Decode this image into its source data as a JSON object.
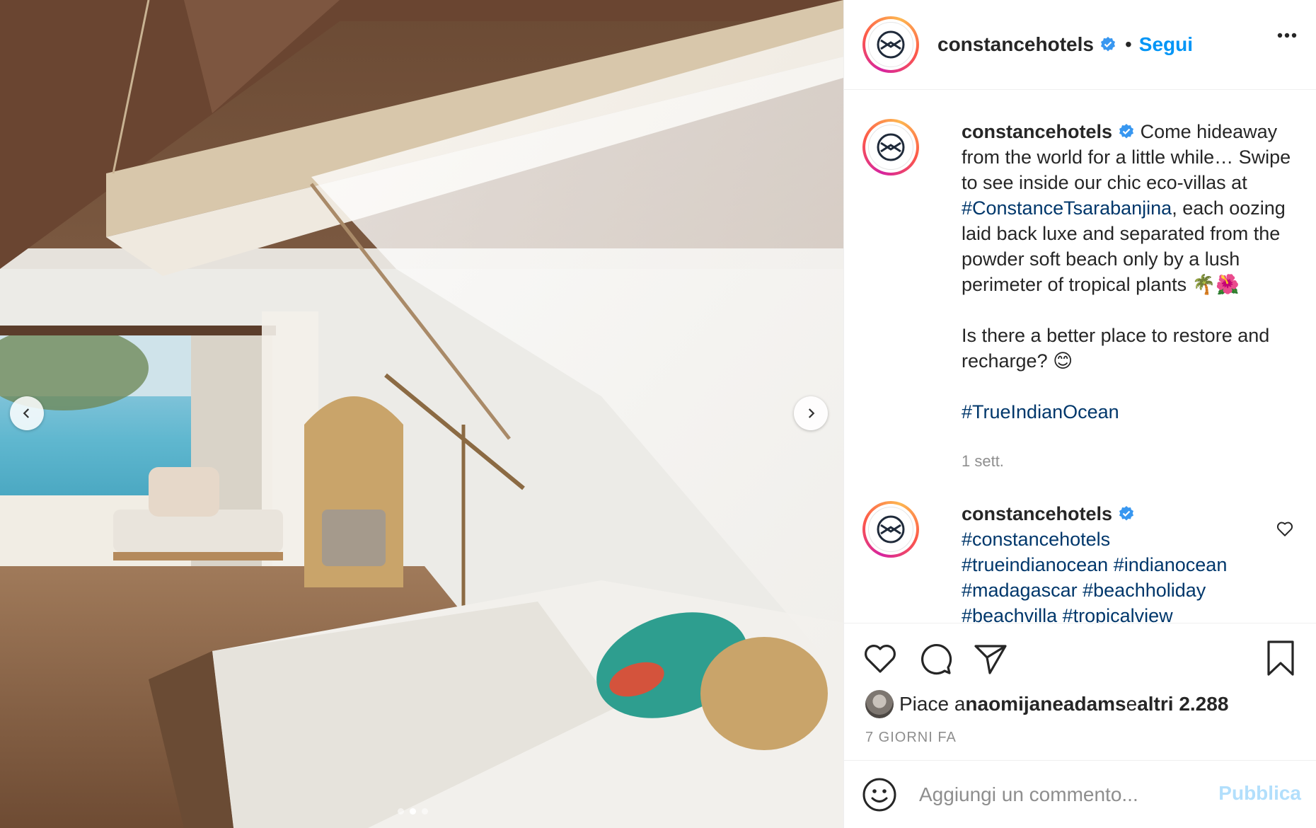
{
  "colors": {
    "accent": "#0095f6",
    "hashtag": "#00376b",
    "muted": "#8e8e8e",
    "text": "#262626",
    "verified": "#3897f0",
    "publish_disabled": "#b2dffc"
  },
  "header": {
    "username": "constancehotels",
    "separator": "•",
    "follow_label": "Segui",
    "more_icon": "more-horizontal-icon"
  },
  "carousel": {
    "slides": 3,
    "active_index": 1,
    "prev_icon": "chevron-left-icon",
    "next_icon": "chevron-right-icon"
  },
  "caption": {
    "username": "constancehotels",
    "text_part1": "Come hideaway from the world for a little while… Swipe to see inside our chic eco-villas at ",
    "tag1": "#ConstanceTsarabanjina",
    "text_part2": ", each oozing laid back luxe and separated from the powder soft beach only by a lush perimeter of tropical plants 🌴🌺",
    "text_para2": "Is there a better place to restore and recharge? 😊",
    "tag2": "#TrueIndianOcean",
    "time": "1 sett."
  },
  "comment": {
    "username": "constancehotels",
    "tags": [
      "#constancehotels",
      "#trueindianocean",
      "#indianocean",
      "#madagascar",
      "#beachholiday",
      "#beachvilla",
      "#tropicalview"
    ]
  },
  "actions": {
    "like_icon": "heart-icon",
    "comment_icon": "comment-icon",
    "share_icon": "paper-plane-icon",
    "save_icon": "bookmark-icon"
  },
  "likes": {
    "prefix": "Piace a ",
    "user": "naomijaneadams",
    "middle": " e ",
    "others": "altri 2.288"
  },
  "posted_ago": "7 GIORNI FA",
  "add_comment": {
    "placeholder": "Aggiungi un commento...",
    "publish_label": "Pubblica"
  }
}
